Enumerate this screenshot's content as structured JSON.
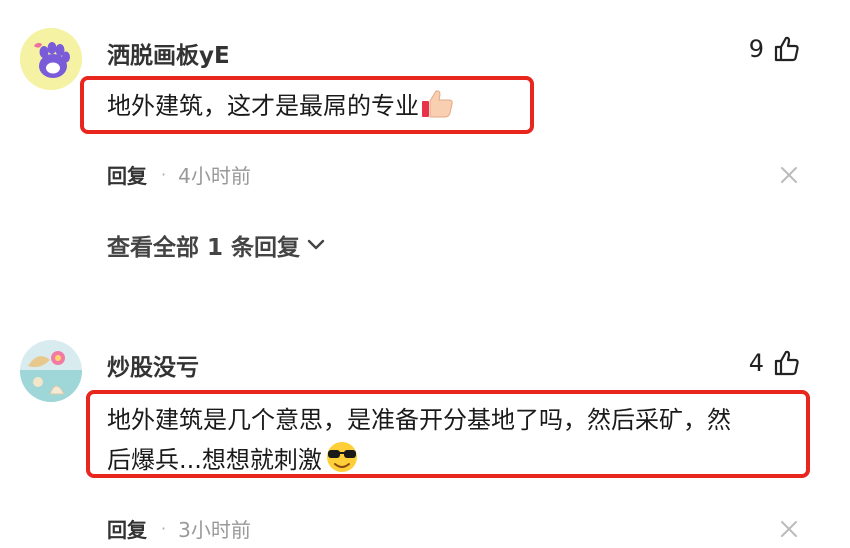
{
  "comments": [
    {
      "username": "洒脱画板yE",
      "likes": "9",
      "text": "地外建筑，这才是最屌的专业",
      "emoji": "thumbs-up-emoji",
      "reply_label": "回复",
      "time": "4小时前",
      "view_replies": "查看全部 1 条回复"
    },
    {
      "username": "炒股没亏",
      "likes": "4",
      "text_line1": "地外建筑是几个意思，是准备开分基地了吗，然后采矿，然",
      "text_line2": "后爆兵...想想就刺激",
      "emoji": "sunglasses-emoji",
      "reply_label": "回复",
      "time": "3小时前"
    }
  ],
  "colors": {
    "highlight_border": "#e8261e"
  }
}
